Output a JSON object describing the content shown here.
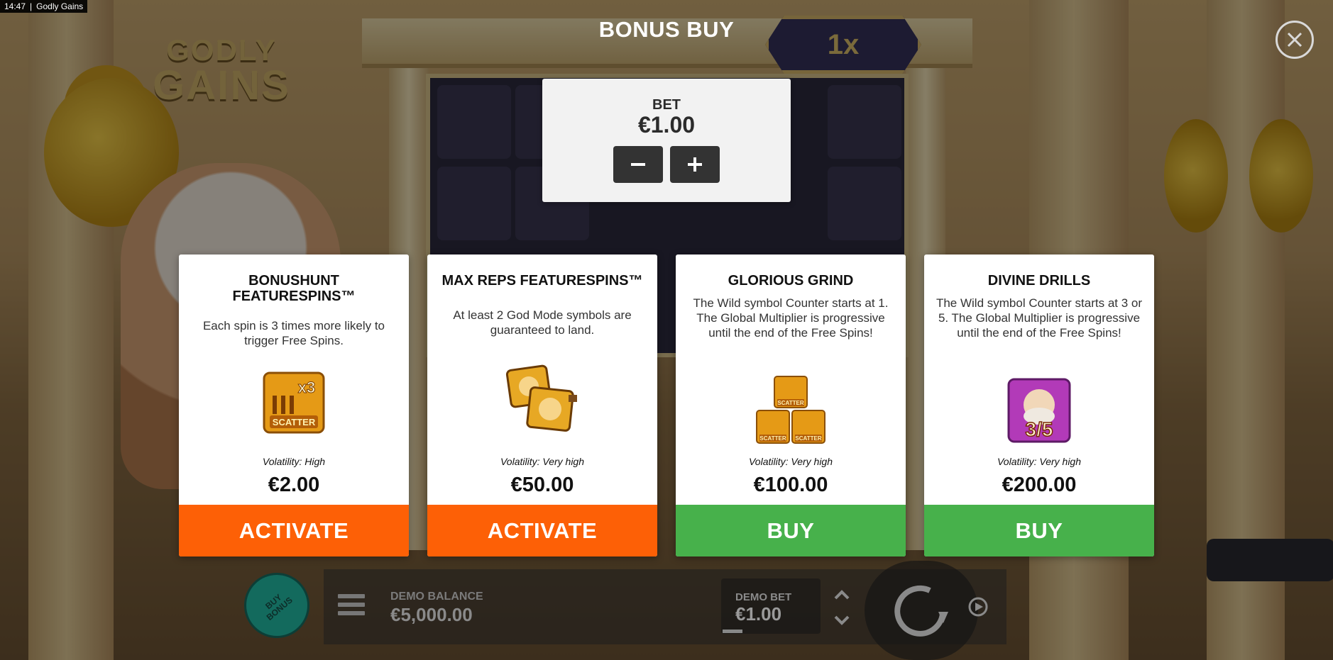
{
  "status_bar": {
    "time": "14:47",
    "app_title": "Godly Gains"
  },
  "game": {
    "logo_line1": "GODLY",
    "logo_line2": "GAINS",
    "multiplier": "1x"
  },
  "modal": {
    "title": "BONUS BUY",
    "close_icon": "close-icon",
    "bet": {
      "label": "BET",
      "value": "€1.00",
      "minus_icon": "minus-icon",
      "plus_icon": "plus-icon"
    },
    "cards": [
      {
        "title": "BONUSHUNT FEATURESPINS™",
        "description": "Each spin is 3 times more likely to trigger Free Spins.",
        "image_text": "SCATTER",
        "image_badge": "x3",
        "volatility": "Volatility: High",
        "price": "€2.00",
        "action": "ACTIVATE",
        "action_color": "#fd6006"
      },
      {
        "title": "MAX REPS FEATURESPINS™",
        "description": "At least 2 God Mode symbols are guaranteed to land.",
        "volatility": "Volatility: Very high",
        "price": "€50.00",
        "action": "ACTIVATE",
        "action_color": "#fd6006"
      },
      {
        "title": "GLORIOUS GRIND",
        "description": "The Wild symbol Counter starts at 1. The Global Multiplier is progressive until the end of the Free Spins!",
        "image_text": "SCATTER",
        "volatility": "Volatility: Very high",
        "price": "€100.00",
        "action": "BUY",
        "action_color": "#47b14b"
      },
      {
        "title": "DIVINE DRILLS",
        "description": "The Wild symbol Counter starts at 3 or 5. The Global Multiplier is progressive until the end of the Free Spins!",
        "image_badge": "3/5",
        "volatility": "Volatility: Very high",
        "price": "€200.00",
        "action": "BUY",
        "action_color": "#47b14b"
      }
    ]
  },
  "hud": {
    "buy_bonus_label": "BUY BONUS",
    "demo_balance_label": "DEMO BALANCE",
    "demo_balance_value": "€5,000.00",
    "demo_bet_label": "DEMO BET",
    "demo_bet_value": "€1.00",
    "icons": [
      "menu-icon",
      "chevron-up-icon",
      "chevron-down-icon",
      "spin-icon",
      "autoplay-icon"
    ]
  }
}
